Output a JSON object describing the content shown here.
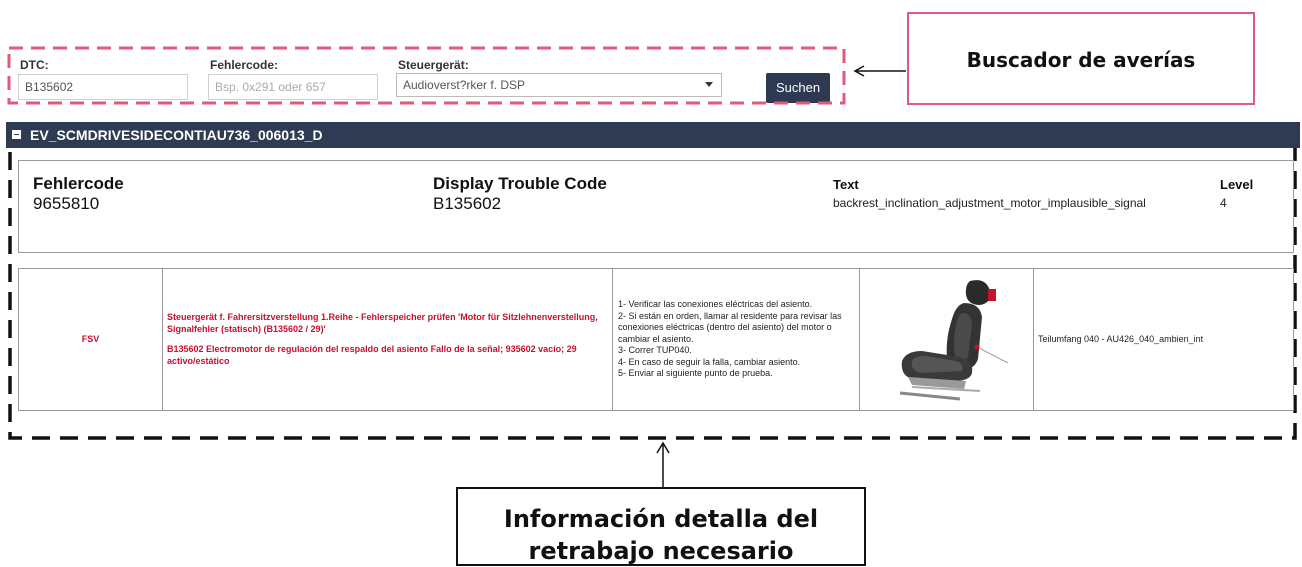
{
  "search": {
    "dtc_label": "DTC:",
    "dtc_value": "B135602",
    "fehlercode_label": "Fehlercode:",
    "fehlercode_placeholder": "Bsp. 0x291 oder 657",
    "steuergeraet_label": "Steuergerät:",
    "steuergeraet_value": "Audioverst?rker f. DSP",
    "search_button": "Suchen"
  },
  "callouts": {
    "search_callout": "Buscador de averías",
    "info_line1": "Información detalla del",
    "info_line2": "retrabajo necesario"
  },
  "result": {
    "panel_title": "EV_SCMDRIVESIDECONTIAU736_006013_D",
    "fehlercode_title": "Fehlercode",
    "fehlercode_value": "9655810",
    "dtc_title": "Display Trouble Code",
    "dtc_value": "B135602",
    "text_title": "Text",
    "text_value": "backrest_inclination_adjustment_motor_implausible_signal",
    "level_title": "Level",
    "level_value": "4"
  },
  "detail_row": {
    "system": "FSV",
    "description_line1": "Steuergerät f. Fahrersitzverstellung 1.Reihe - Fehlerspeicher prüfen  'Motor für Sitzlehnenverstellung, Signalfehler (statisch) (B135602 / 29)'",
    "description_line2": "B135602 Electromotor de regulación del respaldo del asiento Fallo de la señal; 935602 vacío; 29 activo/estático",
    "steps": [
      "1-  Verificar las conexiones eléctricas del asiento.",
      "2- Si están en orden, llamar al residente para revisar las conexiones eléctricas (dentro del asiento) del motor o cambiar el asiento.",
      "3- Correr TUP040.",
      "4- En caso de seguir la falla, cambiar asiento.",
      "5- Enviar al siguiente punto de prueba."
    ],
    "image_icon": "car-seat-image",
    "teilumfang": "Teilumfang 040 - AU426_040_ambien_int"
  },
  "colors": {
    "header_bar": "#2f3b52",
    "button": "#2d3a52",
    "callout_pink": "#e05a7a",
    "red_text": "#c8102e"
  }
}
